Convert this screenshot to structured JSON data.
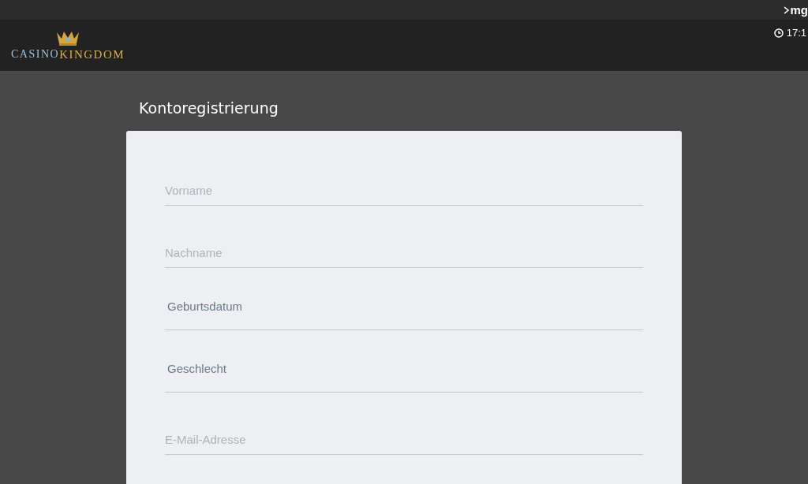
{
  "top_strip": {
    "brand": "mg"
  },
  "header": {
    "logo": {
      "part_1": "CASINO",
      "part_2": "KINGDOM"
    },
    "clock": "17:1"
  },
  "page": {
    "title": "Kontoregistrierung"
  },
  "form": {
    "fields": [
      {
        "kind": "text",
        "placeholder": "Vorname"
      },
      {
        "kind": "text",
        "placeholder": "Nachname"
      },
      {
        "kind": "select",
        "label": "Geburtsdatum"
      },
      {
        "kind": "select",
        "label": "Geschlecht"
      },
      {
        "kind": "text",
        "placeholder": "E-Mail-Adresse"
      }
    ]
  }
}
